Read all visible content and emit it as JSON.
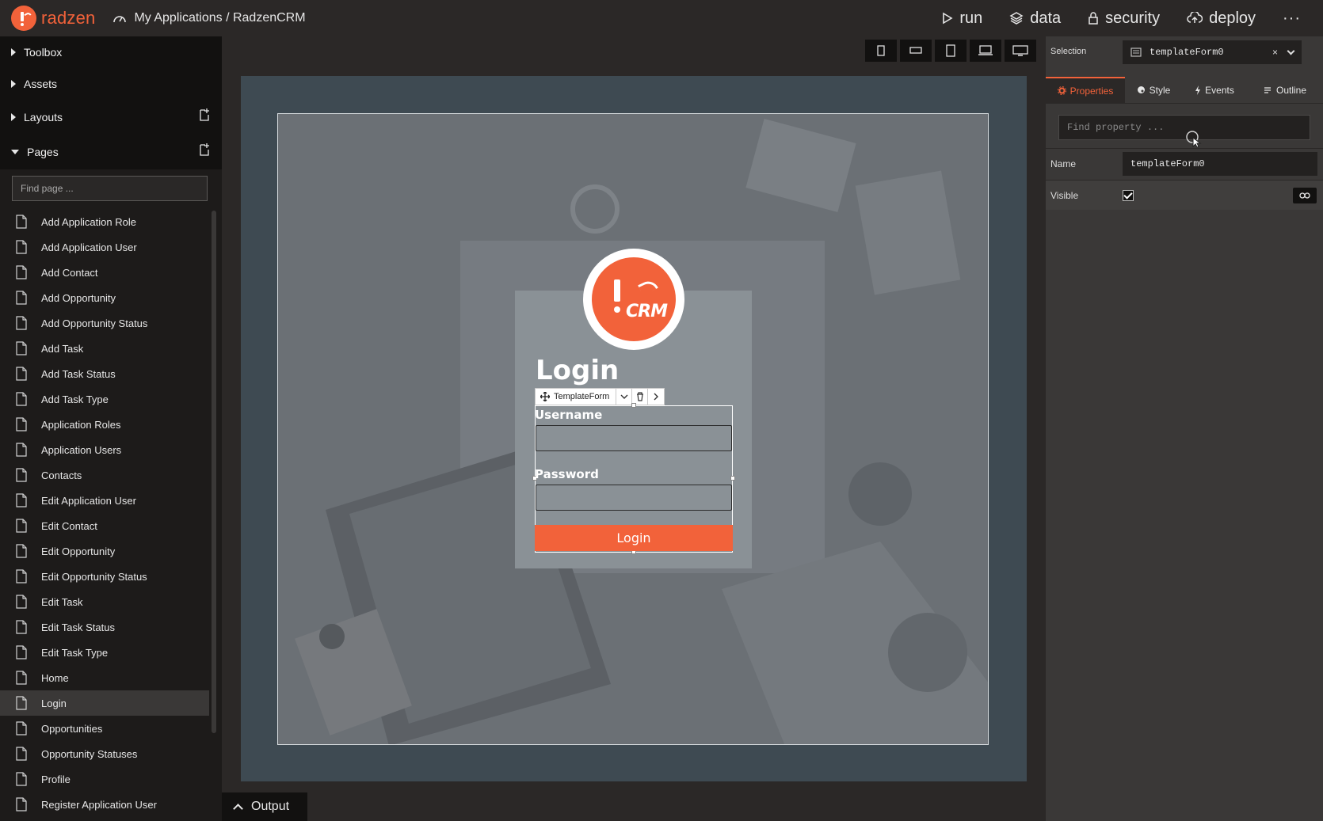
{
  "app": {
    "logo_text": "radzen",
    "breadcrumb": "My Applications / RadzenCRM"
  },
  "topnav": [
    {
      "label": "run",
      "icon": "play-icon"
    },
    {
      "label": "data",
      "icon": "layers-icon"
    },
    {
      "label": "security",
      "icon": "lock-icon"
    },
    {
      "label": "deploy",
      "icon": "cloud-upload-icon"
    }
  ],
  "topnav_more": "···",
  "sidebar": {
    "sections": [
      "Toolbox",
      "Assets",
      "Layouts",
      "Pages"
    ],
    "find_page_placeholder": "Find page ...",
    "pages": [
      "Add Application Role",
      "Add Application User",
      "Add Contact",
      "Add Opportunity",
      "Add Opportunity Status",
      "Add Task",
      "Add Task Status",
      "Add Task Type",
      "Application Roles",
      "Application Users",
      "Contacts",
      "Edit Application User",
      "Edit Contact",
      "Edit Opportunity",
      "Edit Opportunity Status",
      "Edit Task",
      "Edit Task Status",
      "Edit Task Type",
      "Home",
      "Login",
      "Opportunities",
      "Opportunity Statuses",
      "Profile",
      "Register Application User"
    ],
    "active_page": "Login"
  },
  "canvas": {
    "logo_crm": "CRM",
    "login_title": "Login",
    "toolbar_label": "TemplateForm",
    "username_label": "Username",
    "password_label": "Password",
    "login_button": "Login"
  },
  "output_tab": "Output",
  "right_panel": {
    "selection_label": "Selection",
    "selection_value": "templateForm0",
    "selection_clear": "×",
    "tabs": [
      "Properties",
      "Style",
      "Events",
      "Outline"
    ],
    "active_tab": "Properties",
    "find_property_placeholder": "Find property ...",
    "properties": [
      {
        "name": "Name",
        "value": "templateForm0"
      },
      {
        "name": "Visible",
        "value": "checked"
      }
    ]
  },
  "colors": {
    "accent": "#f2623a",
    "topbar": "#2b2827",
    "sidebar": "#1d1b1a",
    "panel": "#3a3837"
  }
}
